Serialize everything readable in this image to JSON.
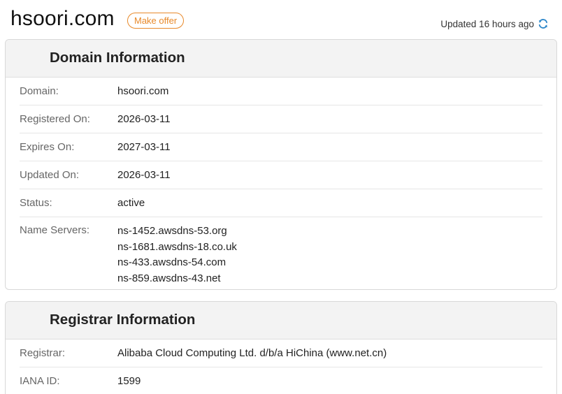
{
  "header": {
    "domain": "hsoori.com",
    "offer_label": "Make offer",
    "updated_text": "Updated 16 hours ago"
  },
  "domain_info": {
    "title": "Domain Information",
    "rows": [
      {
        "label": "Domain:",
        "value": "hsoori.com"
      },
      {
        "label": "Registered On:",
        "value": "2026-03-11"
      },
      {
        "label": "Expires On:",
        "value": "2027-03-11"
      },
      {
        "label": "Updated On:",
        "value": "2026-03-11"
      },
      {
        "label": "Status:",
        "value": "active"
      }
    ],
    "name_servers_label": "Name Servers:",
    "name_servers": [
      "ns-1452.awsdns-53.org",
      "ns-1681.awsdns-18.co.uk",
      "ns-433.awsdns-54.com",
      "ns-859.awsdns-43.net"
    ]
  },
  "registrar_info": {
    "title": "Registrar Information",
    "rows": [
      {
        "label": "Registrar:",
        "value": "Alibaba Cloud Computing Ltd. d/b/a HiChina (www.net.cn)"
      },
      {
        "label": "IANA ID:",
        "value": "1599"
      }
    ]
  },
  "colors": {
    "accent_orange": "#e8892a",
    "refresh_blue": "#2b86c9",
    "card_header_bg": "#f3f3f3"
  },
  "icons": {
    "refresh": "refresh-icon"
  }
}
